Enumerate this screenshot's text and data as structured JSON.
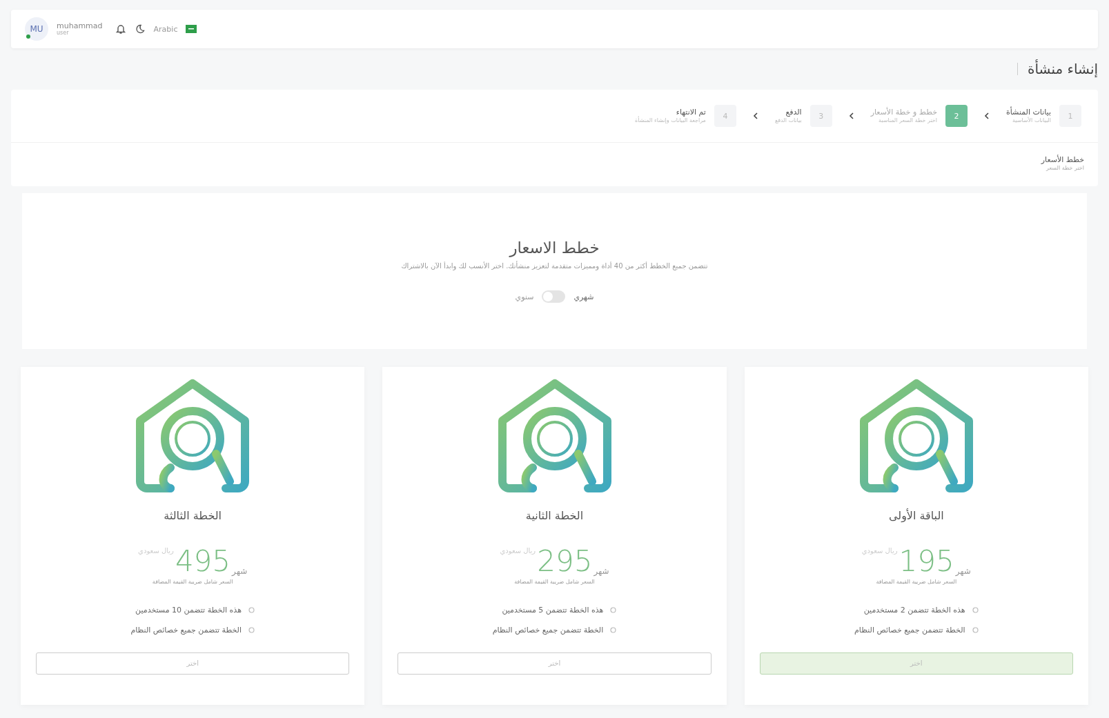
{
  "header": {
    "user": {
      "initials": "MU",
      "name": "muhammad",
      "role": "user",
      "online": true
    },
    "language": "Arabic"
  },
  "page_title": "إنشاء منشأة",
  "steps": [
    {
      "number": "1",
      "title": "بيانات المنشأة",
      "subtitle": "البيانات الأساسية",
      "selected": false
    },
    {
      "number": "2",
      "title": "خطط و خطة الأسعار",
      "subtitle": "اختر خطة السعر المناسبة",
      "selected": true
    },
    {
      "number": "3",
      "title": "الدفع",
      "subtitle": "بيانات الدفع",
      "selected": false
    },
    {
      "number": "4",
      "title": "تم الانتهاء",
      "subtitle": "مراجعة البيانات وإنشاء المنشأة",
      "selected": false
    }
  ],
  "section": {
    "title": "خطط الأسعار",
    "subtitle": "اختر خطة السعر"
  },
  "pricing": {
    "title": "خطط الاسعار",
    "description": "تتضمن جميع الخطط أكثر من 40 أداة ومميزات متقدمة لتعزيز منشأتك. اختر الأنسب لك وابدأ الآن بالاشتراك",
    "billing": {
      "monthly_label": "شهري",
      "yearly_label": "سنوي",
      "on": false
    }
  },
  "plans": [
    {
      "name": "الباقة الأولى",
      "price": "195",
      "currency": "ريال سعودي",
      "period": "شهر",
      "note": "السعر شامل ضريبة القيمة المضافة",
      "features": [
        "هذه الخطة تتضمن 2 مستخدمين",
        "الخطة تتضمن جميع خصائص النظام"
      ],
      "button": "اختر",
      "selected": true
    },
    {
      "name": "الخطة الثانية",
      "price": "295",
      "currency": "ريال سعودي",
      "period": "شهر",
      "note": "السعر شامل ضريبة القيمة المضافة",
      "features": [
        "هذه الخطة تتضمن 5 مستخدمين",
        "الخطة تتضمن جميع خصائص النظام"
      ],
      "button": "اختر",
      "selected": false
    },
    {
      "name": "الخطة الثالثة",
      "price": "495",
      "currency": "ريال سعودي",
      "period": "شهر",
      "note": "السعر شامل ضريبة القيمة المضافة",
      "features": [
        "هذه الخطة تتضمن 10 مستخدمين",
        "الخطة تتضمن جميع خصائص النظام"
      ],
      "button": "اختر",
      "selected": false
    }
  ]
}
